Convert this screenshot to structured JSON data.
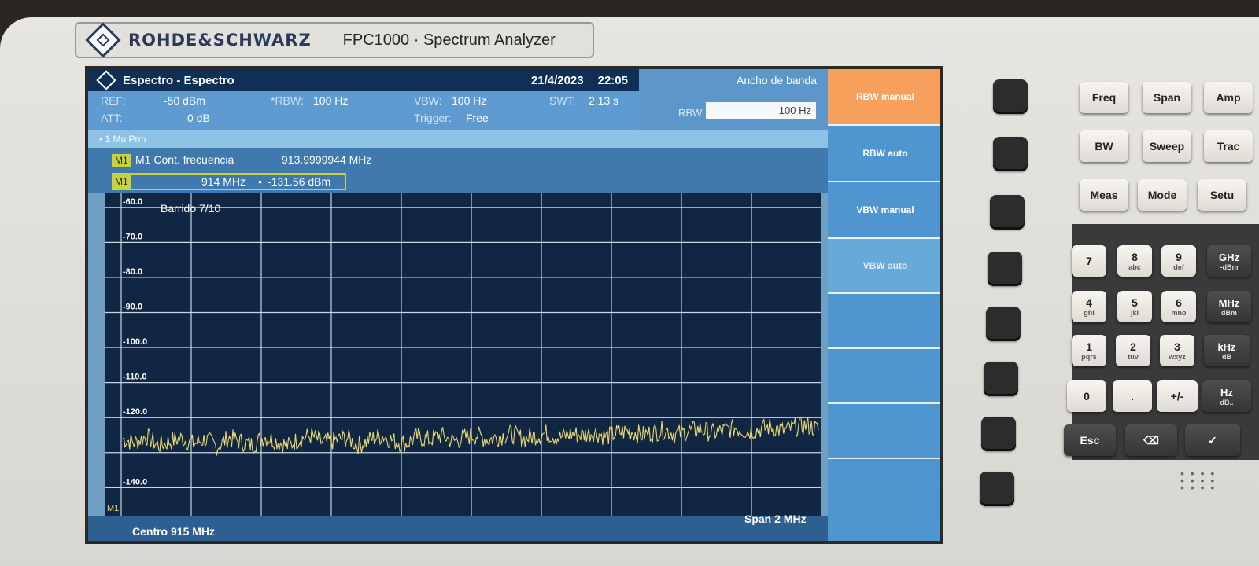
{
  "device": {
    "brand": "ROHDE&SCHWARZ",
    "model": "FPC1000 · Spectrum Analyzer"
  },
  "titlebar": {
    "title": "Espectro - Espectro",
    "date": "21/4/2023",
    "time": "22:05"
  },
  "params": {
    "ref_label": "REF:",
    "ref_value": "-50 dBm",
    "att_label": "ATT:",
    "att_value": "0 dB",
    "rbw_label": "*RBW:",
    "rbw_value": "100 Hz",
    "vbw_label": "VBW:",
    "vbw_value": "100 Hz",
    "trigger_label": "Trigger:",
    "trigger_value": "Free",
    "swt_label": "SWT:",
    "swt_value": "2.13 s"
  },
  "trace_info": "• 1 Mu  Prm",
  "marker": {
    "tag": "M1",
    "name": "M1 Cont. frecuencia",
    "cont_freq": "913.9999944 MHz",
    "readout_freq": "914 MHz",
    "readout_bullet": "•",
    "readout_level": "-131.56 dBm"
  },
  "rbw_panel": {
    "title": "Ancho de banda",
    "field_label": "RBW",
    "field_value": "100 Hz"
  },
  "plot": {
    "sweep_label": "Barrido 7/10",
    "y_ticks": [
      "-60.0",
      "-70.0",
      "-80.0",
      "-90.0",
      "-100.0",
      "-110.0",
      "-120.0",
      "",
      "-140.0"
    ],
    "center": "Centro 915 MHz",
    "span": "Span 2 MHz",
    "marker_flag": "M1"
  },
  "softkeys": [
    {
      "label": "RBW manual",
      "state": "active"
    },
    {
      "label": "RBW auto",
      "state": "normal"
    },
    {
      "label": "VBW manual",
      "state": "normal"
    },
    {
      "label": "VBW auto",
      "state": "dim"
    },
    {
      "label": "",
      "state": "normal"
    },
    {
      "label": "",
      "state": "normal"
    },
    {
      "label": "",
      "state": "normal"
    }
  ],
  "hardkeys": {
    "function": [
      "Freq",
      "Span",
      "Amp",
      "BW",
      "Sweep",
      "Trac",
      "Meas",
      "Mode",
      "Setu"
    ],
    "digits": [
      {
        "main": "7",
        "sub": ""
      },
      {
        "main": "8",
        "sub": "abc"
      },
      {
        "main": "9",
        "sub": "def"
      },
      {
        "main": "4",
        "sub": "ghi"
      },
      {
        "main": "5",
        "sub": "jkl"
      },
      {
        "main": "6",
        "sub": "mno"
      },
      {
        "main": "1",
        "sub": "pqrs"
      },
      {
        "main": "2",
        "sub": "tuv"
      },
      {
        "main": "3",
        "sub": "wxyz"
      }
    ],
    "units": [
      {
        "main": "GHz",
        "sub": "-dBm"
      },
      {
        "main": "MHz",
        "sub": "dBm"
      },
      {
        "main": "kHz",
        "sub": "dB"
      },
      {
        "main": "Hz",
        "sub": "dB.."
      }
    ],
    "zero": "0",
    "dot": ".",
    "sign": "+/-",
    "esc": "Esc",
    "backspace": "⌫",
    "enter": "✓"
  },
  "colors": {
    "trace": "#e9d873",
    "grid": "#c9d6e6",
    "plot_bg": "#102642",
    "active_softkey": "#f7a05b",
    "marker_tag": "#c8d23a"
  },
  "chart_data": {
    "type": "line",
    "title": "",
    "xlabel": "",
    "ylabel": "",
    "x_range_text": [
      "Centro 915 MHz",
      "Span 2 MHz"
    ],
    "xlim_mhz": [
      914,
      916
    ],
    "ylim": [
      -148,
      -56
    ],
    "y_ticks": [
      -60,
      -70,
      -80,
      -90,
      -100,
      -110,
      -120,
      -140
    ],
    "grid": true,
    "series": [
      {
        "values": [
          -126.0,
          -127.2,
          -125.3,
          -128.0,
          -126.8,
          -125.9,
          -127.5,
          -126.1,
          -128.3,
          -125.7,
          -126.9,
          -127.8,
          -125.4,
          -126.6,
          -128.1,
          -126.0,
          -125.2,
          -127.3,
          -126.5,
          -125.8,
          -127.9,
          -126.2,
          -125.1,
          -126.7,
          -127.4,
          -125.5,
          -126.3,
          -125.0,
          -126.8,
          -125.6,
          -124.9,
          -126.4,
          -125.3,
          -124.7,
          -126.1,
          -125.2,
          -124.4,
          -125.8,
          -124.6,
          -125.0,
          -124.1,
          -125.5,
          -124.3,
          -123.8,
          -125.0,
          -124.2,
          -123.5,
          -124.8,
          -123.9,
          -123.2,
          -124.5,
          -123.7,
          -122.9,
          -124.0,
          -123.3,
          -122.6,
          -123.8,
          -122.8,
          -122.2,
          -123.4
        ]
      }
    ],
    "markers": [
      {
        "name": "M1",
        "x_mhz": 914,
        "y": -131.56
      }
    ]
  }
}
